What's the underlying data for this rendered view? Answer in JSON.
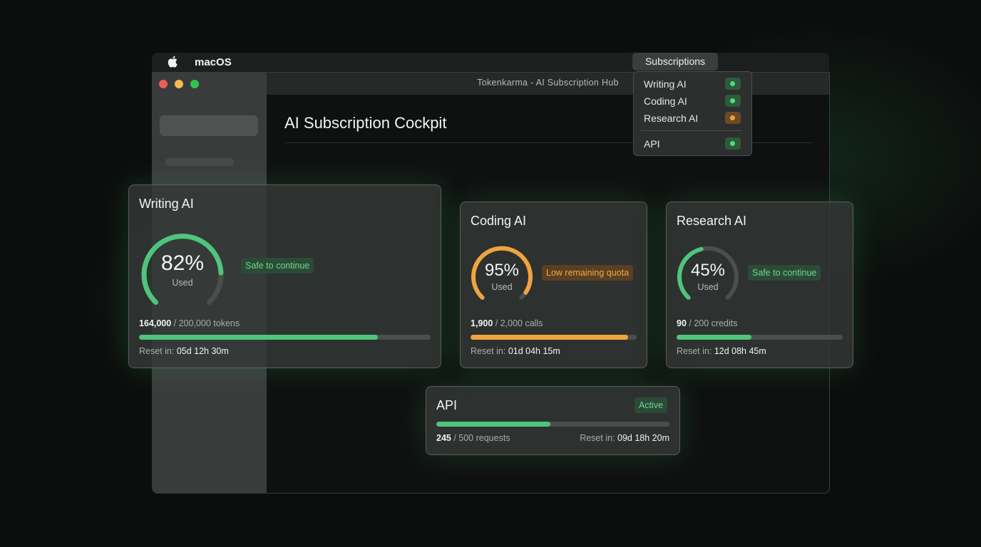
{
  "menubar": {
    "os_label": "macOS",
    "subscriptions_label": "Subscriptions"
  },
  "window": {
    "title": "Tokenkarma - AI Subscription Hub",
    "page_title": "AI Subscription Cockpit"
  },
  "dropdown": {
    "items": [
      {
        "label": "Writing AI",
        "status": "green"
      },
      {
        "label": "Coding AI",
        "status": "green"
      },
      {
        "label": "Research AI",
        "status": "orange"
      },
      {
        "label": "API",
        "status": "green"
      }
    ]
  },
  "cards": {
    "writing": {
      "title": "Writing AI",
      "percent": "82%",
      "percent_value": 82,
      "used_label": "Used",
      "badge": "Safe to continue",
      "used": "164,000",
      "total": " / 200,000 tokens",
      "bar_fraction": 0.82,
      "reset_label": "Reset in: ",
      "reset_value": "05d 12h 30m"
    },
    "coding": {
      "title": "Coding AI",
      "percent": "95%",
      "percent_value": 95,
      "used_label": "Used",
      "badge": "Low remaining quota",
      "used": "1,900",
      "total": " / 2,000 calls",
      "bar_fraction": 0.95,
      "reset_label": "Reset in: ",
      "reset_value": "01d 04h 15m"
    },
    "research": {
      "title": "Research AI",
      "percent": "45%",
      "percent_value": 45,
      "used_label": "Used",
      "badge": "Safe to continue",
      "used": "90",
      "total": " / 200 credits",
      "bar_fraction": 0.45,
      "reset_label": "Reset in: ",
      "reset_value": "12d 08h 45m"
    },
    "api": {
      "title": "API",
      "badge": "Active",
      "used": "245",
      "total": " / 500 requests",
      "bar_fraction": 0.49,
      "reset_label": "Reset in: ",
      "reset_value": "09d 18h 20m"
    }
  },
  "colors": {
    "green": "#4ec57a",
    "orange": "#f0a33f",
    "track": "#4a4e4d"
  }
}
